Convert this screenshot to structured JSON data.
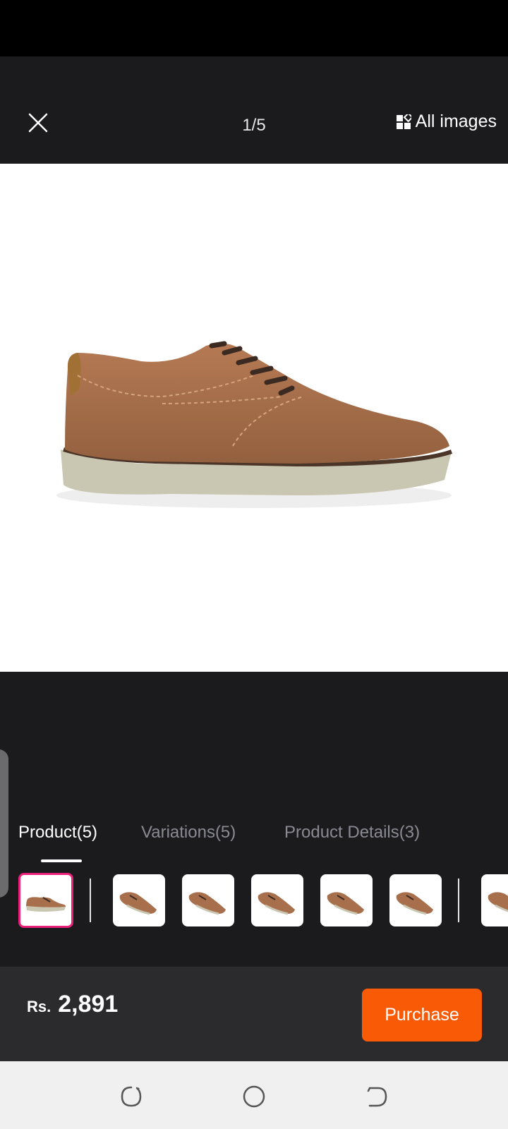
{
  "viewer": {
    "counter": "1/5",
    "all_images_label": "All images"
  },
  "tabs": [
    {
      "label": "Product(5)",
      "active": true
    },
    {
      "label": "Variations(5)",
      "active": false
    },
    {
      "label": "Product Details(3)",
      "active": false
    }
  ],
  "product": {
    "color": "#a86f4c",
    "sole_color": "#c9c6b1"
  },
  "price": {
    "currency": "Rs.",
    "amount": "2,891"
  },
  "actions": {
    "purchase_label": "Purchase"
  },
  "colors": {
    "accent": "#f95a05",
    "selected_border": "#e9207a"
  }
}
